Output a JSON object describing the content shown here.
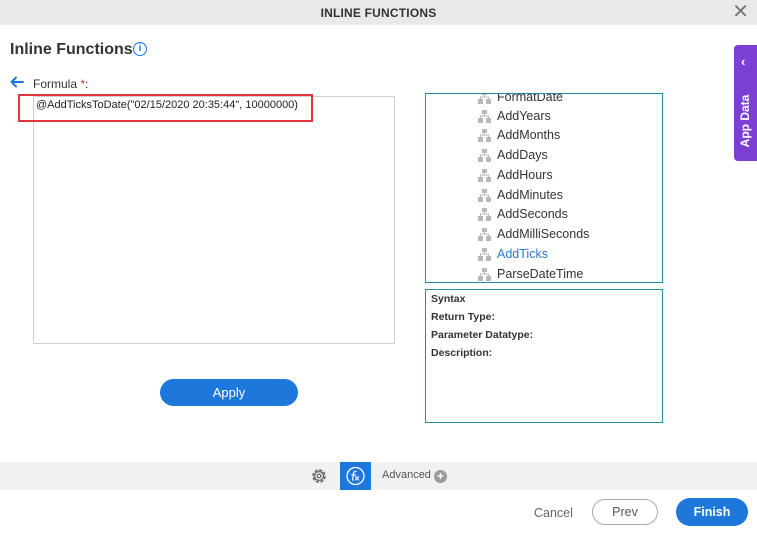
{
  "window": {
    "title": "INLINE FUNCTIONS",
    "close_glyph": "✕"
  },
  "page": {
    "heading": "Inline Functions",
    "info_glyph": "i"
  },
  "formula": {
    "label": "Formula",
    "required_mark": "*",
    "label_suffix": ":",
    "value": "@AddTicksToDate(\"02/15/2020 20:35:44\", 10000000)"
  },
  "apply_label": "Apply",
  "function_tree": {
    "items": [
      {
        "label": "FormatDate",
        "active": false
      },
      {
        "label": "AddYears",
        "active": false
      },
      {
        "label": "AddMonths",
        "active": false
      },
      {
        "label": "AddDays",
        "active": false
      },
      {
        "label": "AddHours",
        "active": false
      },
      {
        "label": "AddMinutes",
        "active": false
      },
      {
        "label": "AddSeconds",
        "active": false
      },
      {
        "label": "AddMilliSeconds",
        "active": false
      },
      {
        "label": "AddTicks",
        "active": true
      },
      {
        "label": "ParseDateTime",
        "active": false
      }
    ]
  },
  "syntax_panel": {
    "syntax": "Syntax",
    "return_type": "Return Type:",
    "parameter_datatype": "Parameter Datatype:",
    "description": "Description:"
  },
  "app_data_tab": {
    "label": "App Data",
    "chevron": "‹"
  },
  "bottom_toolbar": {
    "advanced_label": "Advanced",
    "plus_glyph": "+"
  },
  "footer": {
    "cancel_label": "Cancel",
    "prev_label": "Prev",
    "finish_label": "Finish"
  },
  "colors": {
    "accent": "#1e78dc",
    "highlight": "#e0353b",
    "app_data": "#7b3fd4",
    "panel_border": "#1f8fa0"
  }
}
